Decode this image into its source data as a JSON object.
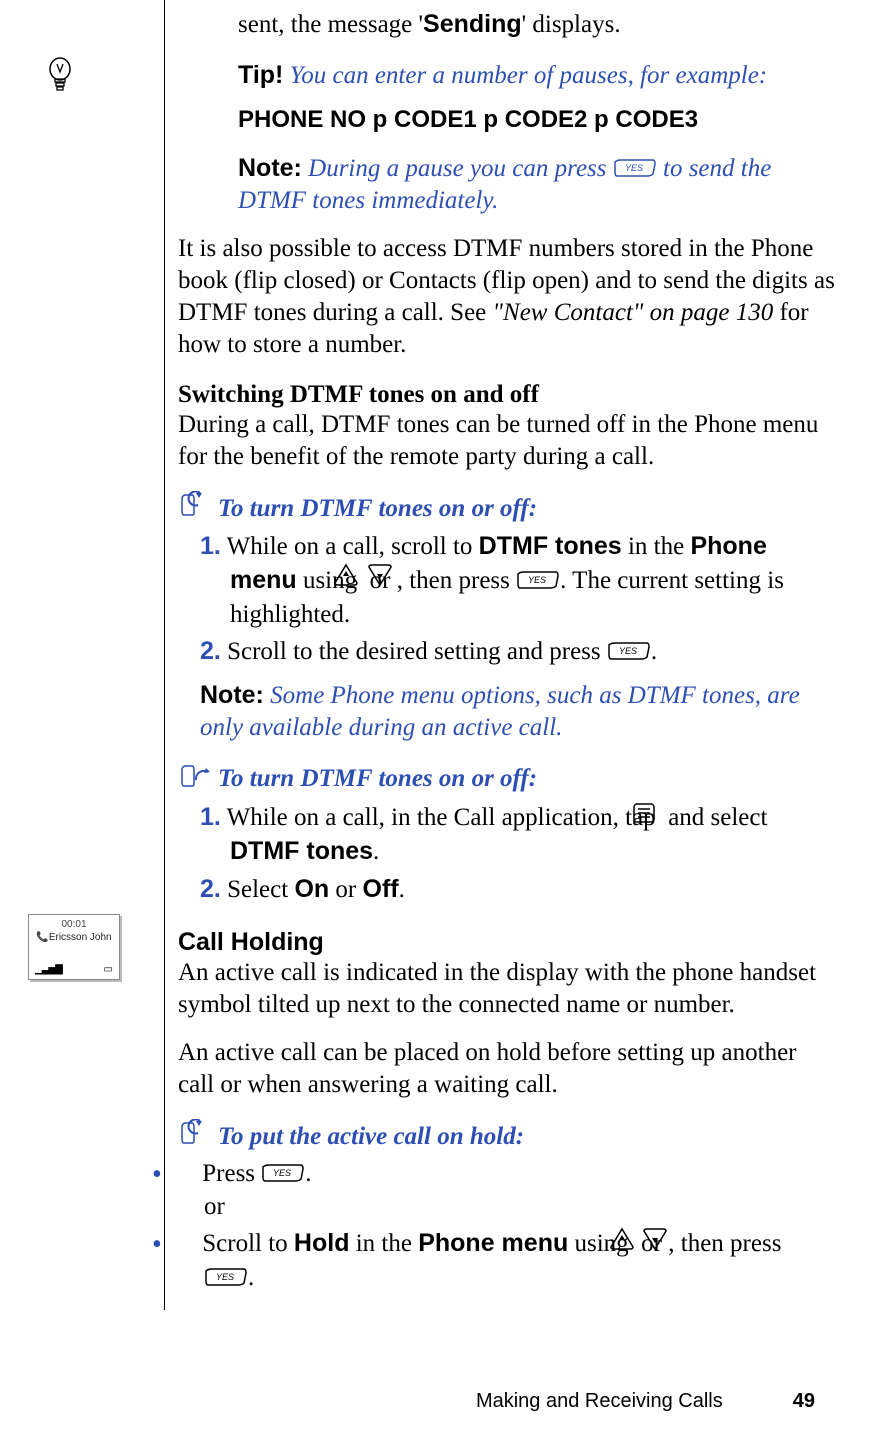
{
  "intro_line": "sent, the message '",
  "intro_bold": "Sending",
  "intro_tail": "' displays.",
  "tip_label": "Tip!",
  "tip_text": " You can enter a number of pauses, for example:",
  "code_line": "PHONE NO p CODE1 p CODE2 p CODE3",
  "note_label": "Note:",
  "note1_a": "  During a pause you can press ",
  "note1_b": " to send the DTMF tones immediately.",
  "para1": "It is also possible to access DTMF numbers stored in the Phone book (flip closed) or Contacts (flip open) and to send the digits as DTMF tones during a call. See ",
  "para1_ref": "\"New Contact\" on page 130",
  "para1_tail": " for how to store a number.",
  "sub1": "Switching DTMF tones on and off",
  "sub1_body": "During a call, DTMF tones can be turned off in the Phone menu for the benefit of the remote party during a call.",
  "proc1_title": "To turn DTMF tones on or off:",
  "proc1_s1_a": " While on a call, scroll to ",
  "proc1_s1_b": "DTMF tones",
  "proc1_s1_c": " in the ",
  "proc1_s1_d": "Phone menu",
  "proc1_s1_e": " using ",
  "proc1_s1_f": " or ",
  "proc1_s1_g": ", then press ",
  "proc1_s1_h": ". The current setting is highlighted.",
  "proc1_s2_a": " Scroll to the desired setting and press ",
  "proc1_s2_b": ".",
  "note2_a": "  Some Phone menu options, such as DTMF tones, are only available during an active call.",
  "proc2_title": "To turn DTMF tones on or off:",
  "proc2_s1_a": " While on a call, in the Call application, tap ",
  "proc2_s1_b": " and select ",
  "proc2_s1_c": "DTMF tones",
  "proc2_s1_d": ".",
  "proc2_s2_a": " Select ",
  "proc2_s2_b": "On",
  "proc2_s2_c": " or ",
  "proc2_s2_d": "Off",
  "proc2_s2_e": ".",
  "section2": "Call Holding",
  "section2_p1": "An active call is indicated in the display with the phone handset symbol tilted up next to the connected name or number.",
  "section2_p2": "An active call can be placed on hold before setting up another call or when answering a waiting call.",
  "proc3_title": "To put the active call on hold:",
  "proc3_b1_a": "Press ",
  "proc3_b1_b": ".",
  "proc3_b1_c": "or",
  "proc3_b2_a": "Scroll to ",
  "proc3_b2_b": "Hold",
  "proc3_b2_c": " in the ",
  "proc3_b2_d": "Phone menu",
  "proc3_b2_e": " using ",
  "proc3_b2_f": " or ",
  "proc3_b2_g": ", then press ",
  "proc3_b2_h": ".",
  "footer_text": "Making and Receiving Calls",
  "page_number": "49",
  "thumb_time": "00:01",
  "thumb_name": "Ericsson John",
  "num1": "1.",
  "num2": "2."
}
